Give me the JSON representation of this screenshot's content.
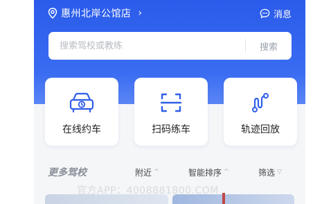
{
  "header": {
    "location": "惠州北岸公馆店",
    "chevron": "›",
    "message_label": "消息"
  },
  "search": {
    "placeholder": "搜索驾校或教练",
    "button_label": "搜索"
  },
  "cards": [
    {
      "label": "在线约车",
      "icon": "car-clock-icon"
    },
    {
      "label": "扫码练车",
      "icon": "scan-icon"
    },
    {
      "label": "轨迹回放",
      "icon": "track-icon"
    }
  ],
  "section": {
    "title": "更多驾校",
    "filters": [
      {
        "label": "附近",
        "arrow": "^"
      },
      {
        "label": "智能排序",
        "arrow": "^"
      },
      {
        "label": "筛选",
        "arrow": "▽"
      }
    ]
  },
  "watermark": "官方APP：4008881800.COM",
  "colors": {
    "brand": "#2a5bea",
    "icon": "#2f5ee8"
  }
}
